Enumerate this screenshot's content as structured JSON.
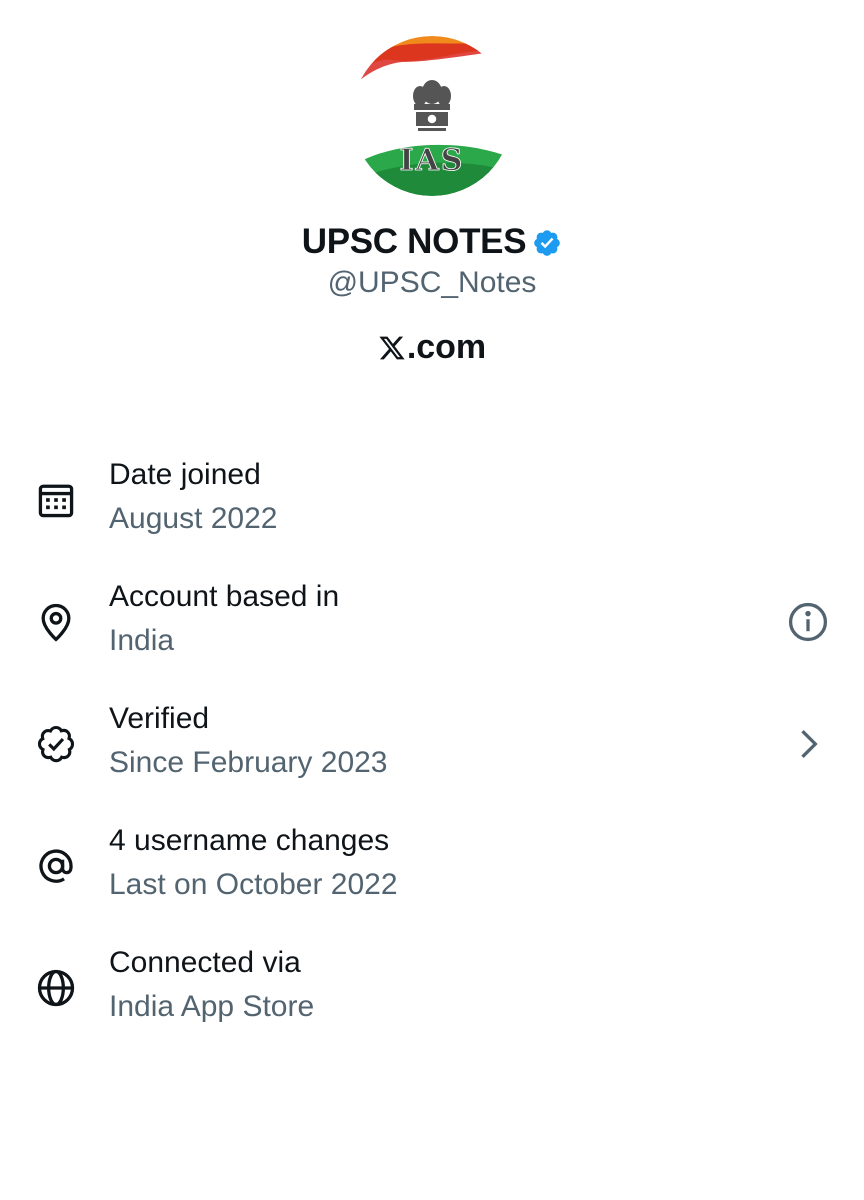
{
  "profile": {
    "display_name": "UPSC NOTES",
    "handle": "@UPSC_Notes",
    "avatar_text": "IAS",
    "source_domain": ".com",
    "verified_color": "#1d9bf0"
  },
  "about_rows": [
    {
      "icon": "calendar-icon",
      "title": "Date joined",
      "subtitle": "August 2022",
      "trailing": null
    },
    {
      "icon": "location-pin-icon",
      "title": "Account based in",
      "subtitle": "India",
      "trailing": "info-icon"
    },
    {
      "icon": "verified-badge-icon",
      "title": "Verified",
      "subtitle": "Since February 2023",
      "trailing": "chevron-right-icon"
    },
    {
      "icon": "at-sign-icon",
      "title": "4 username changes",
      "subtitle": "Last on October 2022",
      "trailing": null
    },
    {
      "icon": "globe-icon",
      "title": "Connected via",
      "subtitle": "India App Store",
      "trailing": null
    }
  ],
  "colors": {
    "primary_text": "#0f1419",
    "secondary_text": "#536471",
    "accent": "#1d9bf0"
  }
}
